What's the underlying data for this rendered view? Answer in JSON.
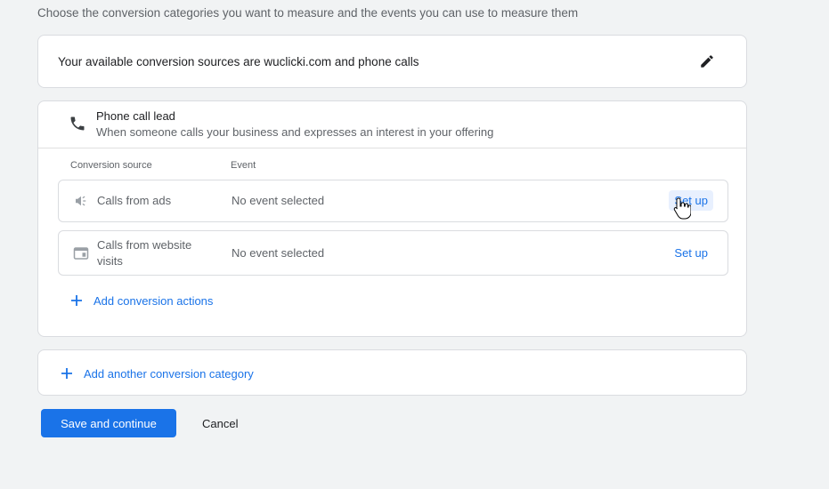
{
  "intro": "Choose the conversion categories you want to measure and the events you can use to measure them",
  "sources": {
    "text": "Your available conversion sources are wuclicki.com and phone calls",
    "edit_icon": "pencil-icon"
  },
  "category": {
    "icon": "phone-icon",
    "title": "Phone call lead",
    "description": "When someone calls your business and expresses an interest in your offering",
    "columns": {
      "source": "Conversion source",
      "event": "Event"
    },
    "rows": [
      {
        "icon": "megaphone-icon",
        "source": "Calls from ads",
        "event": "No event selected",
        "action": "Set up"
      },
      {
        "icon": "web-page-icon",
        "source": "Calls from website visits",
        "event": "No event selected",
        "action": "Set up"
      }
    ],
    "add_actions": "Add conversion actions"
  },
  "add_category": "Add another conversion category",
  "buttons": {
    "save": "Save and continue",
    "cancel": "Cancel"
  },
  "colors": {
    "accent": "#1a73e8",
    "background": "#f1f3f4"
  }
}
